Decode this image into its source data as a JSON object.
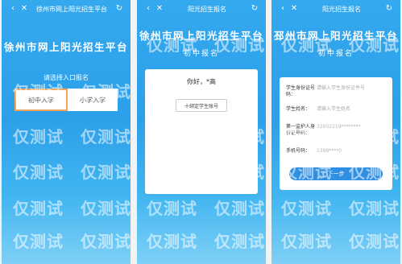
{
  "screen1": {
    "nav_title": "徐州市网上阳光招生平台",
    "back_icon": "chevron-left-icon",
    "close_icon": "close-icon",
    "refresh_icon": "refresh-icon",
    "title": "徐州市网上阳光招生平台",
    "entry_label": "请选择入口报名",
    "buttons": [
      "初中入学",
      "小学入学"
    ]
  },
  "screen2": {
    "nav_title": "阳光招生报名",
    "title": "徐州市网上阳光招生平台",
    "subtitle": "初中报名",
    "greeting": "你好，*高",
    "login_button": "十绑定学生账号"
  },
  "screen3": {
    "nav_title": "阳光招生报名",
    "title": "邳州市网上阳光招生平台",
    "subtitle": "初中报名",
    "fields": [
      {
        "label": "学生身份证号码：",
        "value": "请输入学生身份证件号"
      },
      {
        "label": "学生姓名：",
        "value": "请输入学生姓名"
      },
      {
        "label": "第一监护人身份证号码：",
        "value": "32032219********"
      },
      {
        "label": "手机号码：",
        "value": "1398****0"
      }
    ],
    "next_button": "下一步"
  },
  "watermark": "仅测试"
}
